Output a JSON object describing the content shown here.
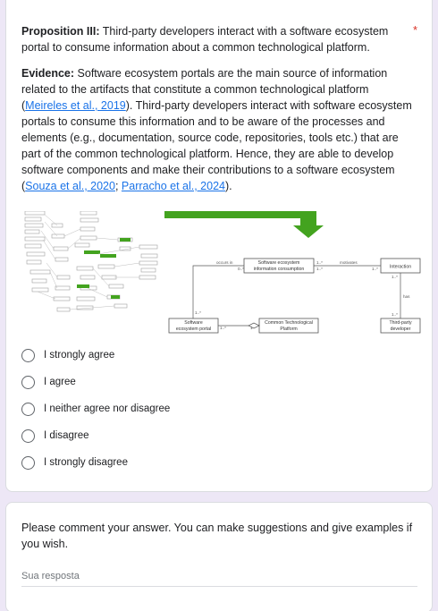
{
  "question": {
    "title_bold": "Proposition III:",
    "title_text": " Third-party developers interact with a software ecosystem portal to consume information about a common technological platform.",
    "required_mark": "*",
    "evidence_label": "Evidence:",
    "evidence_text_1": " Software ecosystem portals are the main source of information related to the artifacts that constitute a common technological platform (",
    "ref_1": "Meireles et al., 2019",
    "evidence_text_2": "). Third-party developers interact with software ecosystem portals to consume this information and to be aware of the processes and elements (e.g., documentation, source code, repositories, tools etc.) that are part of the common technological platform. Hence, they are able to develop software components and make their contributions to a software ecosystem (",
    "ref_2": "Souza et al., 2020",
    "evidence_text_3": ";",
    "ref_3": "Parracho et al., 2024",
    "evidence_text_4": ")."
  },
  "diagram": {
    "node_portal_info": "Software ecosystem information consumption",
    "node_interaction": "Interaction",
    "node_portal": "Software ecosystem portal",
    "node_platform": "Common Technological Platform",
    "node_developer": "Third-party developer",
    "edge_occurs_in": "occurs in",
    "edge_motivates": "motivates",
    "edge_has": "has",
    "mult_0": "0..*",
    "mult_1": "1..*",
    "mult_1b": "1..*",
    "mult_2": "1..*",
    "mult_3": "1..*",
    "mult_4": "1..*",
    "mult_5": "1..*",
    "mult_6": "1",
    "mult_7": "1..*",
    "arrow_color": "#43a31f"
  },
  "options": [
    "I strongly agree",
    "I agree",
    "I neither agree nor disagree",
    "I disagree",
    "I strongly disagree"
  ],
  "comment": {
    "prompt": "Please comment your answer. You can make suggestions and give examples if you wish.",
    "placeholder": "Sua resposta"
  }
}
